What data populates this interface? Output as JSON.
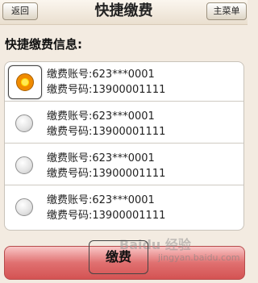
{
  "header": {
    "title": "快捷缴费",
    "back_label": "返回",
    "home_label": "主菜单"
  },
  "section_title": "快捷缴费信息:",
  "records": [
    {
      "account_label": "缴费账号:",
      "account_value": "623***0001",
      "phone_label": "缴费号码:",
      "phone_value": "13900001111",
      "selected": true
    },
    {
      "account_label": "缴费账号:",
      "account_value": "623***0001",
      "phone_label": "缴费号码:",
      "phone_value": "13900001111",
      "selected": false
    },
    {
      "account_label": "缴费账号:",
      "account_value": "623***0001",
      "phone_label": "缴费号码:",
      "phone_value": "13900001111",
      "selected": false
    },
    {
      "account_label": "缴费账号:",
      "account_value": "623***0001",
      "phone_label": "缴费号码:",
      "phone_value": "13900001111",
      "selected": false
    }
  ],
  "pay_button_label": "缴费",
  "watermark": {
    "text": "Baidu 经验",
    "sub": "jingyan.baidu.com"
  }
}
